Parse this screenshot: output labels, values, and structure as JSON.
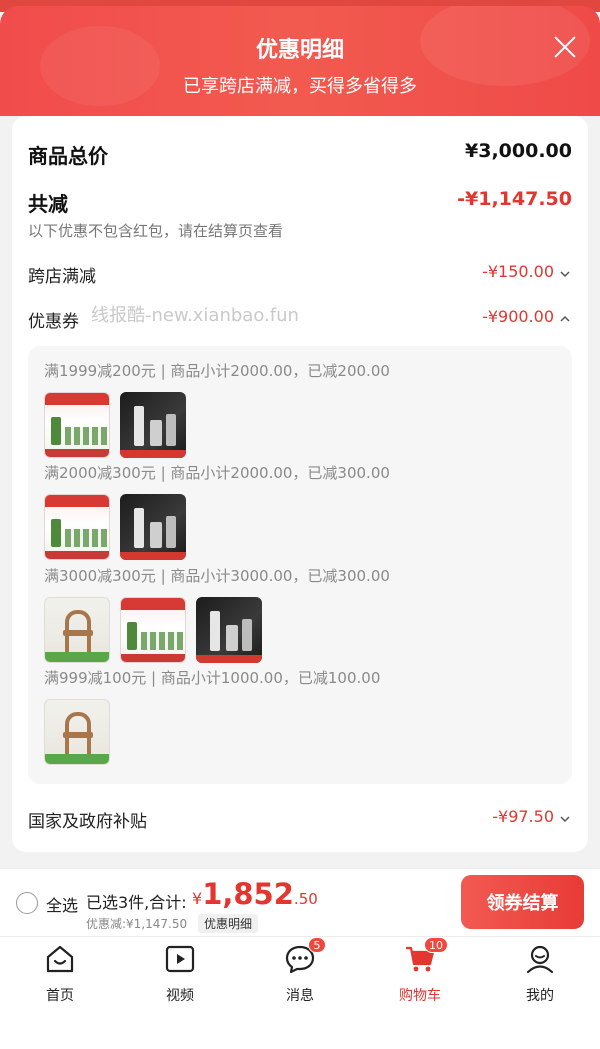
{
  "header": {
    "title": "优惠明细",
    "subtitle": "已享跨店满减，买得多省得多"
  },
  "summary": {
    "total_label": "商品总价",
    "total_value": "¥3,000.00",
    "reduce_label": "共减",
    "reduce_value": "-¥1,147.50",
    "hint": "以下优惠不包含红包，请在结算页查看"
  },
  "lines": {
    "cross_store": {
      "label": "跨店满减",
      "value": "-¥150.00",
      "expanded": false
    },
    "coupon": {
      "label": "优惠券",
      "value": "-¥900.00",
      "expanded": true
    },
    "gov": {
      "label": "国家及政府补贴",
      "value": "-¥97.50",
      "expanded": false
    }
  },
  "watermark": "线报酷-new.xianbao.fun",
  "coupon_tiers": [
    {
      "text": "满1999减200元 | 商品小计2000.00，已减200.00",
      "items": [
        "serum-set",
        "dark-set"
      ]
    },
    {
      "text": "满2000减300元 | 商品小计2000.00，已减300.00",
      "items": [
        "serum-set",
        "dark-set"
      ]
    },
    {
      "text": "满3000减300元 | 商品小计3000.00，已减300.00",
      "items": [
        "chair",
        "serum-set",
        "dark-set"
      ]
    },
    {
      "text": "满999减100元 | 商品小计1000.00，已减100.00",
      "items": [
        "chair"
      ]
    }
  ],
  "bottom_bar": {
    "select_all": "全选",
    "summary": "已选3件,合计:",
    "price_currency": "¥",
    "price_int": "1,852",
    "price_dec": ".50",
    "discount": "优惠减:¥1,147.50",
    "detail_tag": "优惠明细",
    "checkout": "领券结算"
  },
  "tabs": [
    {
      "label": "首页",
      "icon": "home-icon"
    },
    {
      "label": "视频",
      "icon": "video-icon"
    },
    {
      "label": "消息",
      "icon": "message-icon",
      "badge": "5"
    },
    {
      "label": "购物车",
      "icon": "cart-icon",
      "badge": "10",
      "active": true
    },
    {
      "label": "我的",
      "icon": "profile-icon"
    }
  ],
  "colors": {
    "accent": "#e2362f",
    "header": "#f14c4c",
    "panel_bg": "#f6f6f6"
  }
}
